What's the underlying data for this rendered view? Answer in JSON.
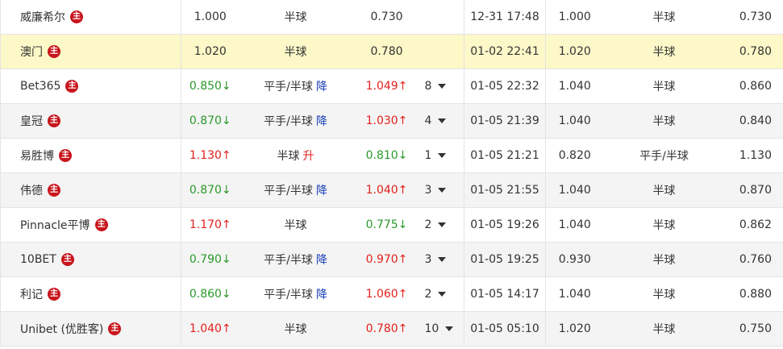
{
  "main_badge": "主",
  "rows": [
    {
      "company": "威廉希尔",
      "open1": "1.000",
      "open1_dir": "",
      "handicap": "半球",
      "change": "",
      "change_dir": "",
      "open2": "0.730",
      "open2_dir": "",
      "count": "",
      "time": "12-31 17:48",
      "init1": "1.000",
      "init_handicap": "半球",
      "init2": "0.730"
    },
    {
      "company": "澳门",
      "open1": "1.020",
      "open1_dir": "",
      "handicap": "半球",
      "change": "",
      "change_dir": "",
      "open2": "0.780",
      "open2_dir": "",
      "count": "",
      "time": "01-02 22:41",
      "init1": "1.020",
      "init_handicap": "半球",
      "init2": "0.780"
    },
    {
      "company": "Bet365",
      "open1": "0.850↓",
      "open1_dir": "down",
      "handicap": "平手/半球",
      "change": "降",
      "change_dir": "down",
      "open2": "1.049↑",
      "open2_dir": "up",
      "count": "8",
      "time": "01-05 22:32",
      "init1": "1.040",
      "init_handicap": "半球",
      "init2": "0.860"
    },
    {
      "company": "皇冠",
      "open1": "0.870↓",
      "open1_dir": "down",
      "handicap": "平手/半球",
      "change": "降",
      "change_dir": "down",
      "open2": "1.030↑",
      "open2_dir": "up",
      "count": "4",
      "time": "01-05 21:39",
      "init1": "1.040",
      "init_handicap": "半球",
      "init2": "0.840"
    },
    {
      "company": "易胜博",
      "open1": "1.130↑",
      "open1_dir": "up",
      "handicap": "半球",
      "change": "升",
      "change_dir": "up",
      "open2": "0.810↓",
      "open2_dir": "down",
      "count": "1",
      "time": "01-05 21:21",
      "init1": "0.820",
      "init_handicap": "平手/半球",
      "init2": "1.130"
    },
    {
      "company": "伟德",
      "open1": "0.870↓",
      "open1_dir": "down",
      "handicap": "平手/半球",
      "change": "降",
      "change_dir": "down",
      "open2": "1.040↑",
      "open2_dir": "up",
      "count": "3",
      "time": "01-05 21:55",
      "init1": "1.040",
      "init_handicap": "半球",
      "init2": "0.870"
    },
    {
      "company": "Pinnacle平博",
      "open1": "1.170↑",
      "open1_dir": "up",
      "handicap": "半球",
      "change": "",
      "change_dir": "",
      "open2": "0.775↓",
      "open2_dir": "down",
      "count": "2",
      "time": "01-05 19:26",
      "init1": "1.040",
      "init_handicap": "半球",
      "init2": "0.862"
    },
    {
      "company": "10BET",
      "open1": "0.790↓",
      "open1_dir": "down",
      "handicap": "平手/半球",
      "change": "降",
      "change_dir": "down",
      "open2": "0.970↑",
      "open2_dir": "up",
      "count": "3",
      "time": "01-05 19:25",
      "init1": "0.930",
      "init_handicap": "半球",
      "init2": "0.760"
    },
    {
      "company": "利记",
      "open1": "0.860↓",
      "open1_dir": "down",
      "handicap": "平手/半球",
      "change": "降",
      "change_dir": "down",
      "open2": "1.060↑",
      "open2_dir": "up",
      "count": "2",
      "time": "01-05 14:17",
      "init1": "1.040",
      "init_handicap": "半球",
      "init2": "0.880"
    },
    {
      "company": "Unibet (优胜客)",
      "open1": "1.040↑",
      "open1_dir": "up",
      "handicap": "半球",
      "change": "",
      "change_dir": "",
      "open2": "0.780↑",
      "open2_dir": "up",
      "count": "10",
      "time": "01-05 05:10",
      "init1": "1.020",
      "init_handicap": "半球",
      "init2": "0.750"
    }
  ]
}
